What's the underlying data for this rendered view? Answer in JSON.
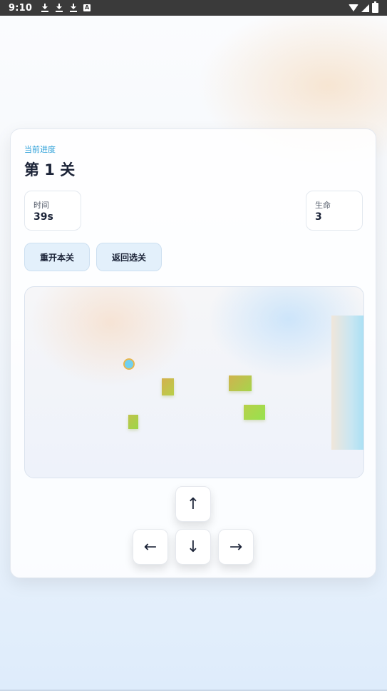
{
  "status_bar": {
    "time": "9:10",
    "left_icons": [
      "download-icon",
      "download-icon",
      "download-icon",
      "a-icon"
    ],
    "a_icon_text": "A",
    "right_icons": [
      "wifi-icon",
      "signal-icon",
      "battery-icon"
    ]
  },
  "progress": {
    "label": "当前进度",
    "level_title": "第 1 关"
  },
  "stats": {
    "time_label": "时间",
    "time_value": "39s",
    "lives_label": "生命",
    "lives_value": "3"
  },
  "buttons": {
    "restart": "重开本关",
    "back": "返回选关"
  },
  "game": {
    "entities": [
      "player",
      "block",
      "block",
      "block",
      "block",
      "exit-zone"
    ],
    "colors": {
      "player": "#6fd0f0",
      "player_border": "#e8b64e",
      "block": "#b8cf4a",
      "exit": "#a9e0f4"
    }
  },
  "dpad": {
    "up": "↑",
    "left": "←",
    "down": "↓",
    "right": "→"
  },
  "colors": {
    "accent": "#2b9fd8",
    "button_bg": "#e3f0fb",
    "text_dark": "#1c2438"
  }
}
